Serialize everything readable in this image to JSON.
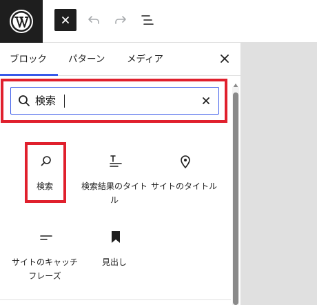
{
  "toolbar": {
    "logo": "wordpress-logo",
    "inserter_toggle_icon": "close-icon",
    "undo_icon": "undo-icon",
    "redo_icon": "redo-icon",
    "outline_icon": "list-view-icon"
  },
  "inserter": {
    "tabs": [
      {
        "label": "ブロック",
        "active": true
      },
      {
        "label": "パターン",
        "active": false
      },
      {
        "label": "メディア",
        "active": false
      }
    ],
    "close_icon": "close-icon",
    "search": {
      "value": "検索",
      "icon": "search-icon",
      "clear_icon": "close-icon"
    },
    "blocks": [
      {
        "label": "検索",
        "icon": "search-icon"
      },
      {
        "label": "検索結果のタイトル",
        "icon": "title-icon"
      },
      {
        "label": "サイトのタイトル",
        "icon": "map-marker-icon"
      },
      {
        "label": "サイトのキャッチフレーズ",
        "icon": "tagline-icon"
      },
      {
        "label": "見出し",
        "icon": "bookmark-icon"
      }
    ]
  },
  "colors": {
    "accent": "#3858e9",
    "highlight": "#e0202d",
    "dark": "#1e1e1e",
    "canvas": "#e0e0e0"
  }
}
